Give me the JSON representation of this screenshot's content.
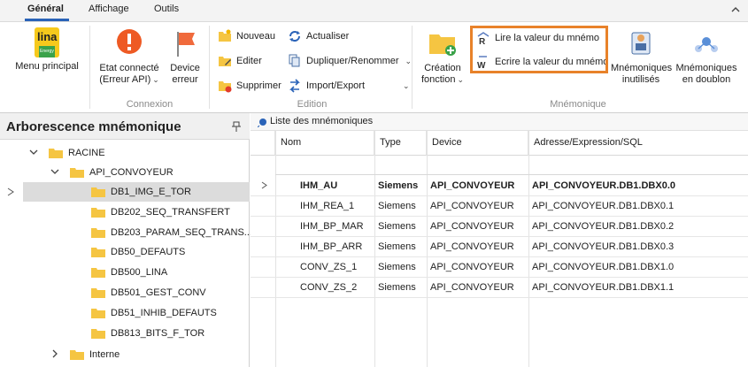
{
  "tabs": [
    {
      "label": "Général",
      "active": true
    },
    {
      "label": "Affichage",
      "active": false
    },
    {
      "label": "Outils",
      "active": false
    }
  ],
  "ribbon": {
    "menu_principal": {
      "label": "Menu principal",
      "logo_text": "lina",
      "logo_sub": "Energy"
    },
    "etat_connecte": {
      "line1": "Etat connecté",
      "line2": "(Erreur API)"
    },
    "device_erreur": {
      "line1": "Device",
      "line2": "erreur"
    },
    "connexion_label": "Connexion",
    "nouveau": "Nouveau",
    "editer": "Editer",
    "supprimer": "Supprimer",
    "actualiser": "Actualiser",
    "dupliquer": "Dupliquer/Renommer",
    "import_export": "Import/Export",
    "edition_label": "Edition",
    "lire": "Lire la valeur du mnémo",
    "ecrire": "Ecrire la valeur du mnémo",
    "creation": {
      "line1": "Création",
      "line2": "fonction"
    },
    "inutilises": {
      "line1": "Mnémoniques",
      "line2": "inutilisés"
    },
    "doublon": {
      "line1": "Mnémoniques",
      "line2": "en doublon"
    },
    "mnemonique_label": "Mnémonique"
  },
  "tree": {
    "title": "Arborescence mnémonique",
    "items": [
      {
        "label": "RACINE",
        "level": 0,
        "expanded": true,
        "has_children": true
      },
      {
        "label": "API_CONVOYEUR",
        "level": 1,
        "expanded": true,
        "has_children": true
      },
      {
        "label": "DB1_IMG_E_TOR",
        "level": 2,
        "selected": true
      },
      {
        "label": "DB202_SEQ_TRANSFERT",
        "level": 2
      },
      {
        "label": "DB203_PARAM_SEQ_TRANS...",
        "level": 2
      },
      {
        "label": "DB50_DEFAUTS",
        "level": 2
      },
      {
        "label": "DB500_LINA",
        "level": 2
      },
      {
        "label": "DB501_GEST_CONV",
        "level": 2
      },
      {
        "label": "DB51_INHIB_DEFAUTS",
        "level": 2
      },
      {
        "label": "DB813_BITS_F_TOR",
        "level": 2
      },
      {
        "label": "Interne",
        "level": 1,
        "expanded": false,
        "has_children": true
      }
    ]
  },
  "list": {
    "title": "Liste des mnémoniques",
    "columns": [
      "Nom",
      "Type",
      "Device",
      "Adresse/Expression/SQL"
    ],
    "rows": [
      {
        "nom": "IHM_AU",
        "type": "Siemens",
        "device": "API_CONVOYEUR",
        "adresse": "API_CONVOYEUR.DB1.DBX0.0",
        "bold": true
      },
      {
        "nom": "IHM_REA_1",
        "type": "Siemens",
        "device": "API_CONVOYEUR",
        "adresse": "API_CONVOYEUR.DB1.DBX0.1"
      },
      {
        "nom": "IHM_BP_MAR",
        "type": "Siemens",
        "device": "API_CONVOYEUR",
        "adresse": "API_CONVOYEUR.DB1.DBX0.2"
      },
      {
        "nom": "IHM_BP_ARR",
        "type": "Siemens",
        "device": "API_CONVOYEUR",
        "adresse": "API_CONVOYEUR.DB1.DBX0.3"
      },
      {
        "nom": "CONV_ZS_1",
        "type": "Siemens",
        "device": "API_CONVOYEUR",
        "adresse": "API_CONVOYEUR.DB1.DBX1.0"
      },
      {
        "nom": "CONV_ZS_2",
        "type": "Siemens",
        "device": "API_CONVOYEUR",
        "adresse": "API_CONVOYEUR.DB1.DBX1.1"
      }
    ]
  },
  "colors": {
    "accent": "#2a63b8",
    "highlight": "#e8822a",
    "folder": "#f5c542",
    "error_red": "#e84c2b"
  }
}
